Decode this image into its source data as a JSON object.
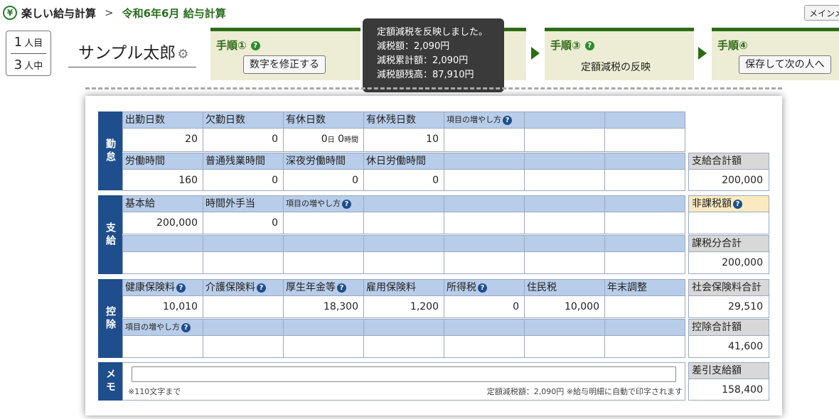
{
  "breadcrumb": {
    "logo": "¥",
    "app": "楽しい給与計算",
    "separator": ">",
    "current": "令和6年6月 給与計算"
  },
  "main_menu": "メインメニュー",
  "person_counter": {
    "current": "1",
    "current_unit": "人目",
    "total": "3",
    "total_unit": "人中"
  },
  "employee": {
    "name": "サンプル太郎",
    "settings_icon": "gear-icon"
  },
  "steps": [
    {
      "title": "手順①",
      "action": "数字を修正する"
    },
    {
      "title": "手順③",
      "text": "定額減税の反映"
    },
    {
      "title": "手順④",
      "action": "保存して次の人へ"
    }
  ],
  "tooltip": {
    "line1": "定額減税を反映しました。",
    "line2": "減税額：2,090円",
    "line3": "減税累計額：2,090円",
    "line4": "減税額残高：87,910円"
  },
  "kintai": {
    "label": "勤怠",
    "headers1": [
      "出勤日数",
      "欠勤日数",
      "有休日数",
      "有休残日数",
      "項目の増やし方"
    ],
    "values1": {
      "attend_days": "20",
      "absent_days": "0",
      "paid_leave_days": "0",
      "paid_leave_day_unit": "日",
      "paid_leave_hours": "0",
      "paid_leave_hour_unit": "時間",
      "paid_leave_remaining": "10"
    },
    "headers2": [
      "労働時間",
      "普通残業時間",
      "深夜労働時間",
      "休日労働時間"
    ],
    "values2": [
      "160",
      "0",
      "0",
      "0"
    ]
  },
  "shikyu": {
    "label": "支給",
    "headers": [
      "基本給",
      "時間外手当",
      "項目の増やし方"
    ],
    "values": [
      "200,000",
      "0"
    ]
  },
  "kojo": {
    "label": "控除",
    "headers": [
      "健康保険料",
      "介護保険料",
      "厚生年金等",
      "雇用保険料",
      "所得税",
      "住民税",
      "年末調整"
    ],
    "values": [
      "10,010",
      "",
      "18,300",
      "1,200",
      "0",
      "10,000",
      ""
    ],
    "add_items": "項目の増やし方"
  },
  "memo": {
    "label": "メモ",
    "hint": "※110文字まで",
    "note": "定額減税額：2,090円 ※給与明細に自動で印字されます"
  },
  "totals": {
    "gross_label": "支給合計額",
    "gross": "200,000",
    "nontax_label": "非課税額",
    "nontax": "",
    "taxable_label": "課税分合計",
    "taxable": "200,000",
    "social_label": "社会保険料合計",
    "social": "29,510",
    "deduct_label": "控除合計額",
    "deduct": "41,600",
    "net_label": "差引支給額",
    "net": "158,400"
  },
  "colors": {
    "brand_green": "#2e6b16",
    "section_blue": "#1f4e8c",
    "header_cell": "#b8cde9"
  }
}
